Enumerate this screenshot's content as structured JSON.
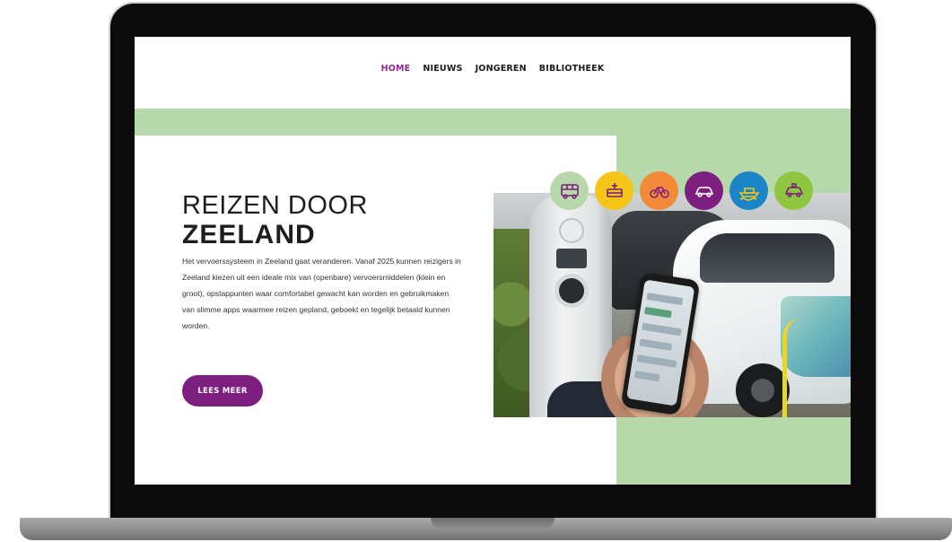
{
  "nav": {
    "items": [
      {
        "label": "HOME",
        "active": true
      },
      {
        "label": "NIEUWS",
        "active": false
      },
      {
        "label": "JONGEREN",
        "active": false
      },
      {
        "label": "BIBLIOTHEEK",
        "active": false
      }
    ]
  },
  "hero": {
    "title_line1": "REIZEN DOOR",
    "title_line2": "ZEELAND",
    "text": "Het vervoerssysteem in Zeeland gaat veranderen. Vanaf 2025 kunnen reizigers in Zeeland kiezen uit een ideale mix van (openbare) vervoersmiddelen (klein en groot), opstappunten waar comfortabel gewacht kan worden en gebruikmaken van slimme apps waarmee reizen gepland, geboekt en tegelijk betaald kunnen worden.",
    "cta_label": "LEES MEER"
  },
  "transport_icons": [
    {
      "icon": "bus-icon",
      "color": "#b6d8ab"
    },
    {
      "icon": "bus-stop-icon",
      "color": "#f5c518"
    },
    {
      "icon": "bicycle-icon",
      "color": "#f38a3a"
    },
    {
      "icon": "car-icon",
      "color": "#7d1f7f"
    },
    {
      "icon": "ferry-icon",
      "color": "#1a86c8"
    },
    {
      "icon": "taxi-icon",
      "color": "#8ec63f"
    }
  ],
  "colors": {
    "accent": "#7d1f7f",
    "green": "#b6d8ab"
  }
}
